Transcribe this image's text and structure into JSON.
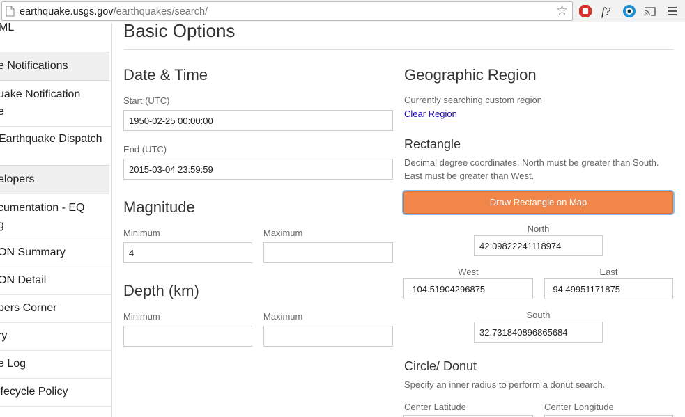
{
  "browser": {
    "url_host": "earthquake.usgs.gov",
    "url_path": "/earthquakes/search/"
  },
  "sidebar": {
    "items": [
      {
        "label": "ML"
      },
      {
        "label": "e Notifications",
        "header": true
      },
      {
        "label": "uake Notification"
      },
      {
        "label": "e"
      },
      {
        "label": "Earthquake Dispatch"
      },
      {
        "label": "elopers",
        "header": true
      },
      {
        "label": "cumentation - EQ"
      },
      {
        "label": "g"
      },
      {
        "label": "ON Summary"
      },
      {
        "label": "ON Detail"
      },
      {
        "label": "pers Corner"
      },
      {
        "label": "ry"
      },
      {
        "label": "e Log"
      },
      {
        "label": "ifecycle Policy"
      }
    ]
  },
  "main": {
    "title": "Basic Options",
    "datetime": {
      "heading": "Date & Time",
      "start_label": "Start (UTC)",
      "start_value": "1950-02-25 00:00:00",
      "end_label": "End (UTC)",
      "end_value": "2015-03-04 23:59:59"
    },
    "magnitude": {
      "heading": "Magnitude",
      "min_label": "Minimum",
      "min_value": "4",
      "max_label": "Maximum",
      "max_value": ""
    },
    "depth": {
      "heading": "Depth (km)",
      "min_label": "Minimum",
      "min_value": "",
      "max_label": "Maximum",
      "max_value": ""
    },
    "geo": {
      "heading": "Geographic Region",
      "status": "Currently searching custom region",
      "clear_link": "Clear Region",
      "rect_heading": "Rectangle",
      "rect_help": "Decimal degree coordinates. North must be greater than South. East must be greater than West.",
      "draw_button": "Draw Rectangle on Map",
      "north_label": "North",
      "north_value": "42.09822241118974",
      "west_label": "West",
      "west_value": "-104.51904296875",
      "east_label": "East",
      "east_value": "-94.49951171875",
      "south_label": "South",
      "south_value": "32.731840896865684",
      "circle_heading": "Circle/ Donut",
      "circle_help": "Specify an inner radius to perform a donut search.",
      "center_lat_label": "Center Latitude",
      "center_lon_label": "Center Longitude"
    }
  }
}
